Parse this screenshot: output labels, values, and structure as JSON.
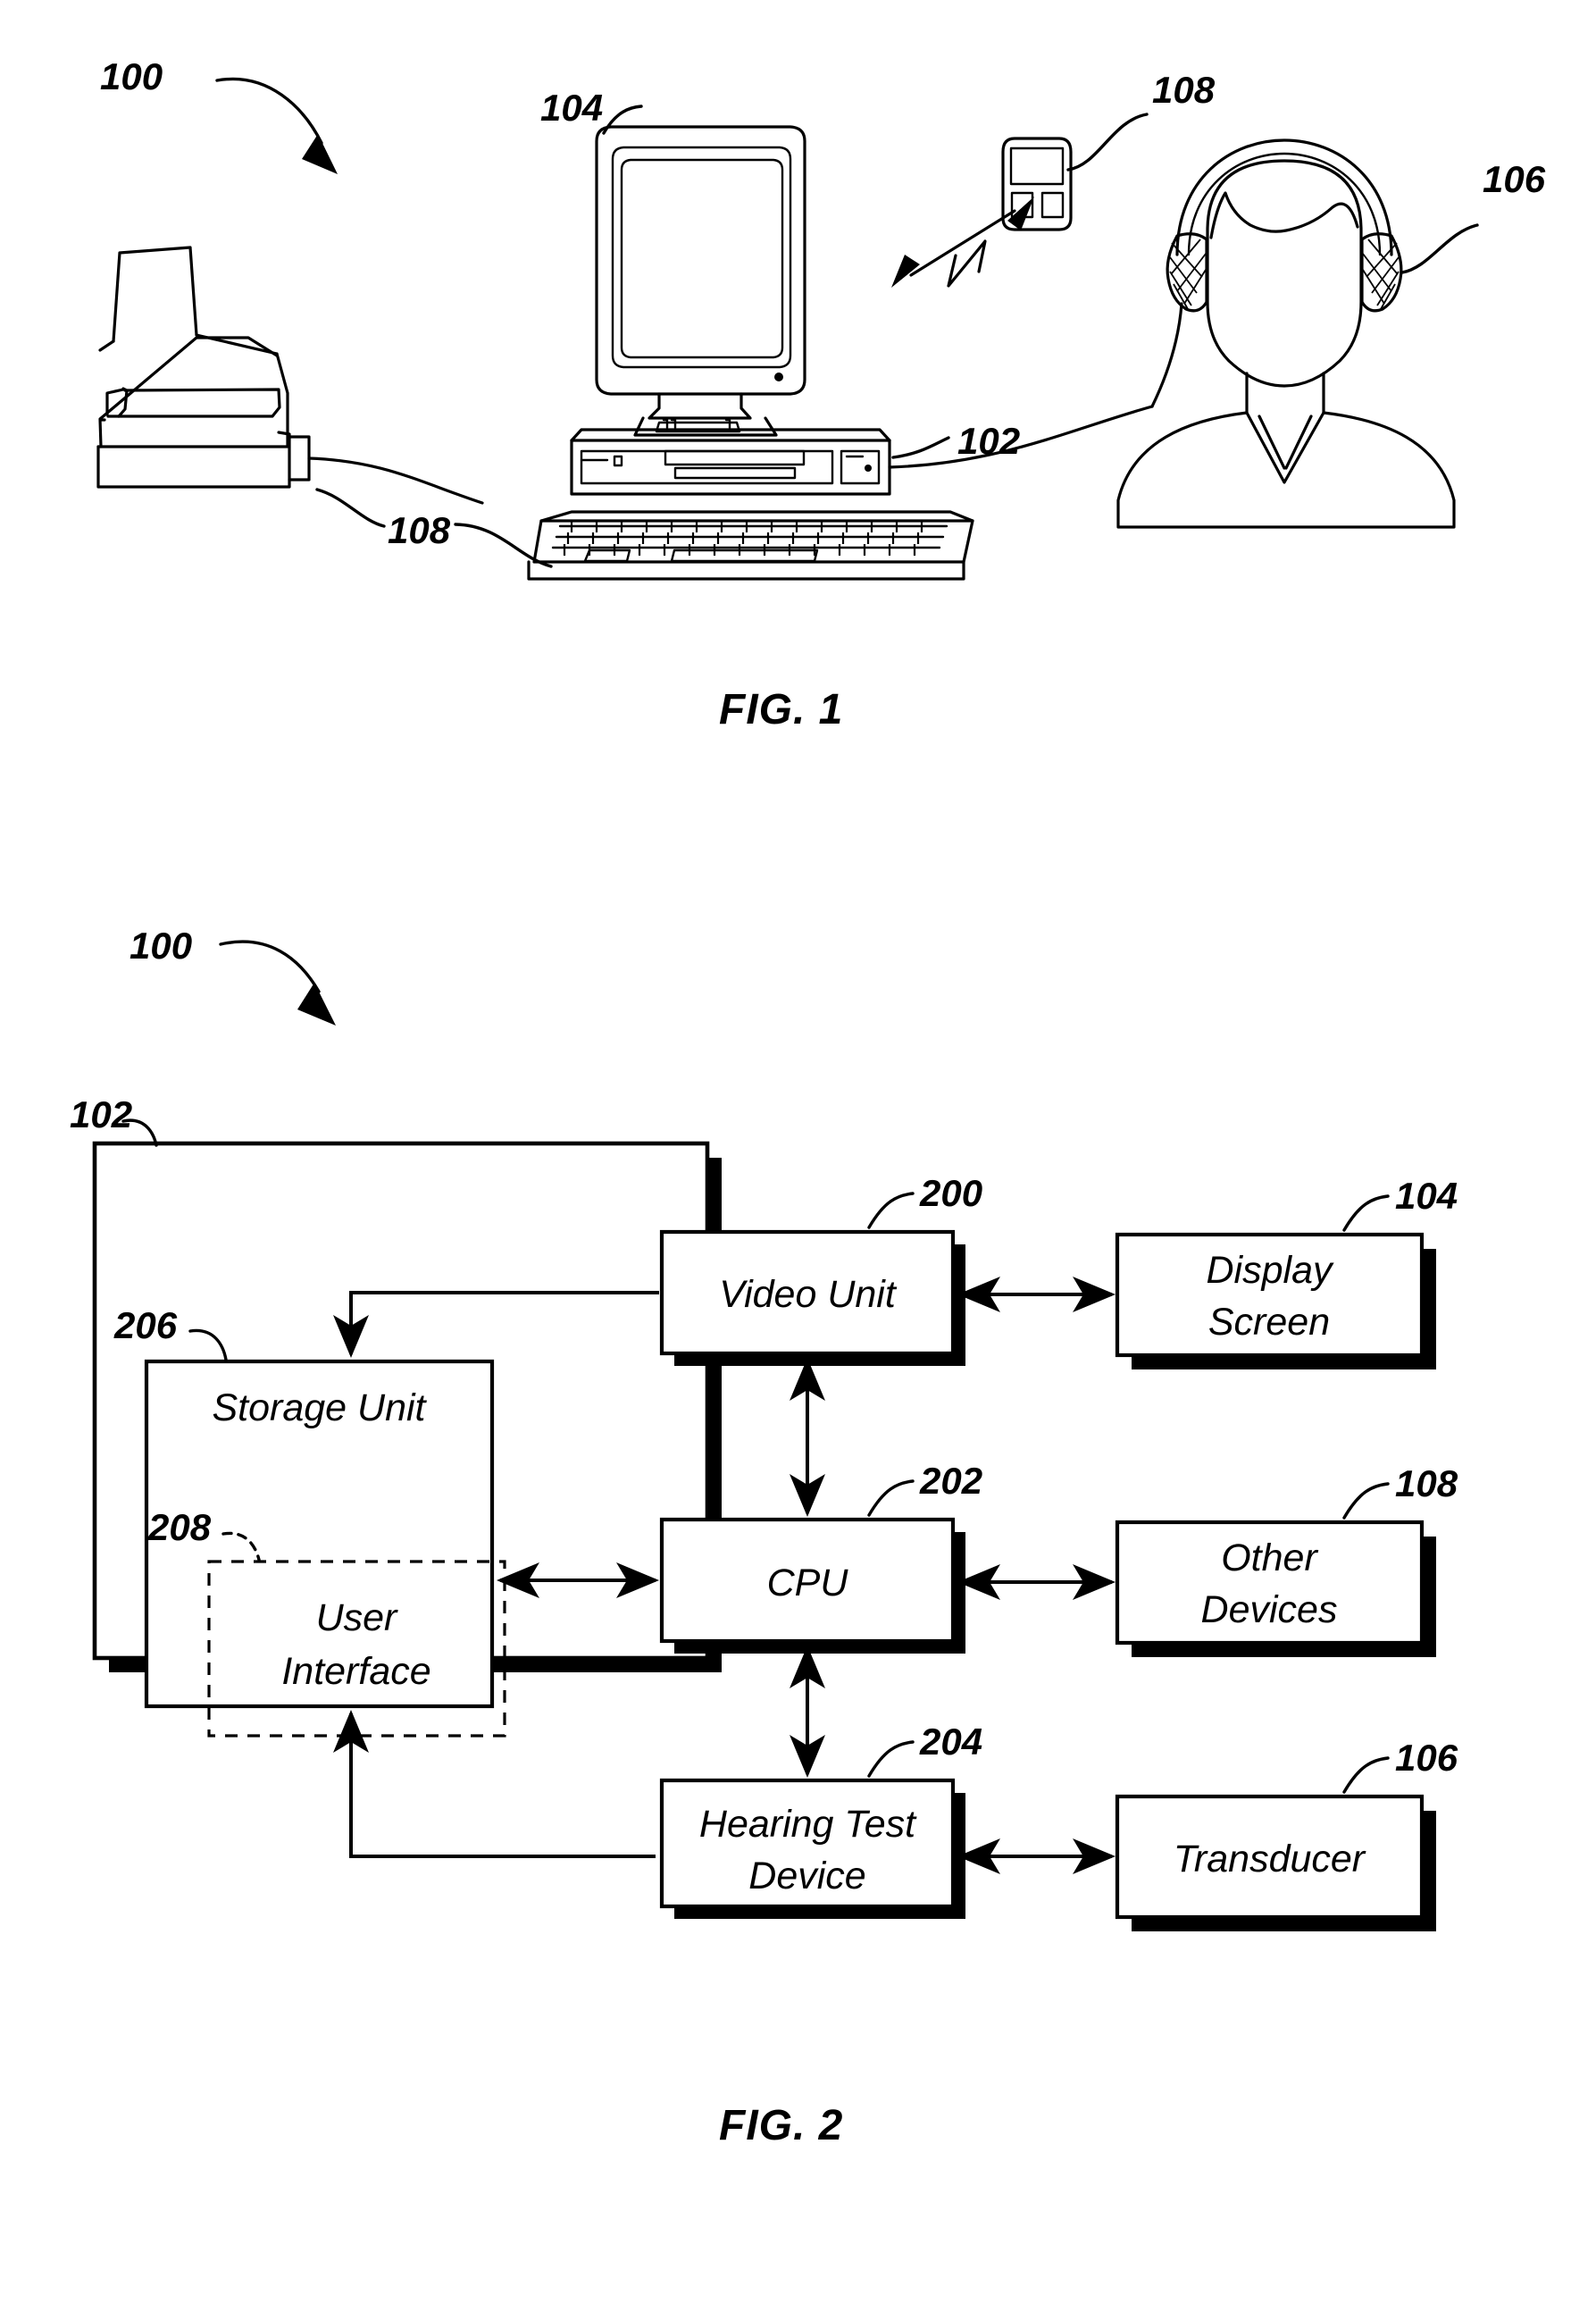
{
  "figures": [
    {
      "caption": "FIG. 1",
      "system_label": "100",
      "callouts": [
        {
          "id": "monitor",
          "number": "104",
          "target": "display monitor"
        },
        {
          "id": "handheld",
          "number": "108",
          "target": "handheld other device"
        },
        {
          "id": "headphones",
          "number": "106",
          "target": "transducer headphones on patient"
        },
        {
          "id": "computer",
          "number": "102",
          "target": "computer tower"
        },
        {
          "id": "printer-keyboard",
          "number": "108",
          "target": "printer and keyboard other devices"
        }
      ],
      "objects": [
        "printer",
        "crt-monitor",
        "computer-tower",
        "keyboard",
        "handheld-device",
        "person-with-headphones",
        "wireless-link"
      ]
    },
    {
      "caption": "FIG. 2",
      "system_label": "100",
      "enclosure": {
        "number": "102",
        "name": "computer"
      },
      "inner_blocks": [
        {
          "number": "200",
          "label": "Video Unit"
        },
        {
          "number": "206",
          "label": "Storage Unit"
        },
        {
          "number": "208",
          "label": "User\nInterface",
          "label_lines": [
            "User",
            "Interface"
          ],
          "dashed": true
        },
        {
          "number": "202",
          "label": "CPU"
        },
        {
          "number": "204",
          "label": "Hearing Test\nDevice",
          "label_lines": [
            "Hearing Test",
            "Device"
          ]
        }
      ],
      "external_blocks": [
        {
          "number": "104",
          "label_lines": [
            "Display",
            "Screen"
          ]
        },
        {
          "number": "108",
          "label_lines": [
            "Other",
            "Devices"
          ]
        },
        {
          "number": "106",
          "label_lines": [
            "Transducer"
          ]
        }
      ],
      "connections": [
        {
          "from": "Storage Unit",
          "to": "Video Unit",
          "type": "single-arrow"
        },
        {
          "from": "Video Unit",
          "to": "CPU",
          "type": "double-arrow"
        },
        {
          "from": "Storage Unit",
          "to": "CPU",
          "type": "double-arrow"
        },
        {
          "from": "CPU",
          "to": "Hearing Test Device",
          "type": "double-arrow"
        },
        {
          "from": "Hearing Test Device",
          "to": "Storage Unit",
          "type": "single-arrow"
        },
        {
          "from": "Video Unit",
          "to": "Display Screen",
          "type": "double-arrow"
        },
        {
          "from": "CPU",
          "to": "Other Devices",
          "type": "double-arrow"
        },
        {
          "from": "Hearing Test Device",
          "to": "Transducer",
          "type": "double-arrow"
        }
      ]
    }
  ],
  "text": {
    "fig1_caption": "FIG. 1",
    "fig2_caption": "FIG. 2",
    "ref_100_a": "100",
    "ref_104_a": "104",
    "ref_108_a": "108",
    "ref_106_a": "106",
    "ref_102_a": "102",
    "ref_108_b": "108",
    "ref_100_b": "100",
    "ref_102_b": "102",
    "ref_200": "200",
    "ref_206": "206",
    "ref_208": "208",
    "ref_202": "202",
    "ref_204": "204",
    "ref_104_b": "104",
    "ref_108_c": "108",
    "ref_106_b": "106",
    "lbl_video_unit": "Video Unit",
    "lbl_storage_unit": "Storage Unit",
    "lbl_user": "User",
    "lbl_interface": "Interface",
    "lbl_cpu": "CPU",
    "lbl_hearing_test": "Hearing Test",
    "lbl_device": "Device",
    "lbl_display": "Display",
    "lbl_screen": "Screen",
    "lbl_other": "Other",
    "lbl_devices": "Devices",
    "lbl_transducer": "Transducer"
  },
  "colors": {
    "ink": "#000000",
    "paper": "#ffffff"
  }
}
